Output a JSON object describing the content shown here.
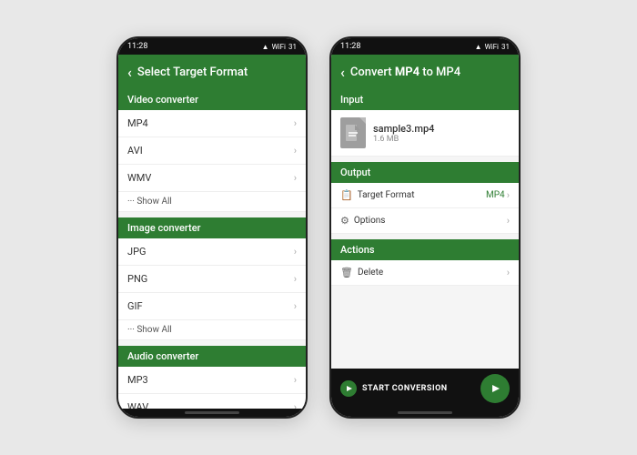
{
  "left_phone": {
    "status_time": "11:28",
    "header": {
      "title": "Select Target Format",
      "back_label": "<"
    },
    "sections": [
      {
        "id": "video",
        "header": "Video converter",
        "items": [
          "MP4",
          "AVI",
          "WMV"
        ],
        "show_all": "··· Show All"
      },
      {
        "id": "image",
        "header": "Image converter",
        "items": [
          "JPG",
          "PNG",
          "GIF"
        ],
        "show_all": "··· Show All"
      },
      {
        "id": "audio",
        "header": "Audio converter",
        "items": [
          "MP3",
          "WAV"
        ]
      }
    ]
  },
  "right_phone": {
    "status_time": "11:28",
    "header": {
      "title_prefix": "Convert ",
      "title_from": "MP4",
      "title_mid": " to ",
      "title_to": "MP4",
      "back_label": "<"
    },
    "input_section": {
      "label": "Input",
      "file_name": "sample3.mp4",
      "file_size": "1.6 MB"
    },
    "output_section": {
      "label": "Output",
      "target_format_label": "Target Format",
      "target_format_value": "MP4",
      "options_label": "Options"
    },
    "actions_section": {
      "label": "Actions",
      "delete_label": "Delete"
    },
    "bottom": {
      "start_label": "START CONVERSION"
    }
  },
  "icons": {
    "chevron": "›",
    "back": "‹",
    "file": "📄",
    "wrench": "⚙",
    "trash": "🗑",
    "format": "📋"
  }
}
